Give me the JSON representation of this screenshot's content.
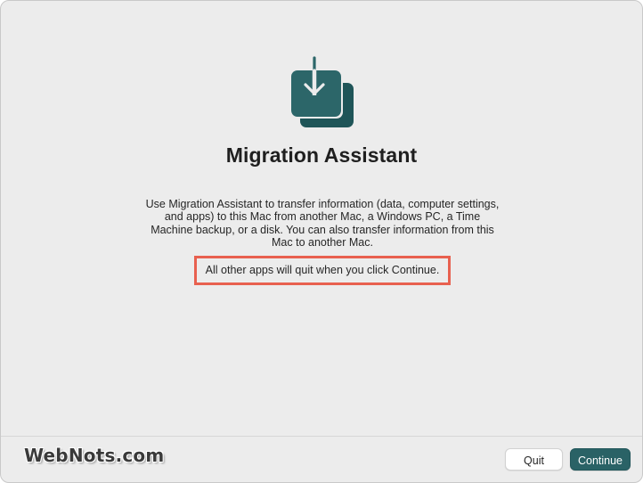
{
  "window": {
    "title": "Migration Assistant",
    "description": "Use Migration Assistant to transfer information (data, computer settings, and apps) to this Mac from another Mac, a Windows PC, a Time Machine backup, or a disk. You can also transfer information from this Mac to another Mac.",
    "notice": "All other apps will quit when you click Continue.",
    "icon": "migration-assistant-icon"
  },
  "footer": {
    "watermark": "WebNots.com",
    "quit_label": "Quit",
    "continue_label": "Continue"
  },
  "colors": {
    "accent": "#2a6266",
    "highlight_border": "#e8604f",
    "background": "#ececec"
  }
}
